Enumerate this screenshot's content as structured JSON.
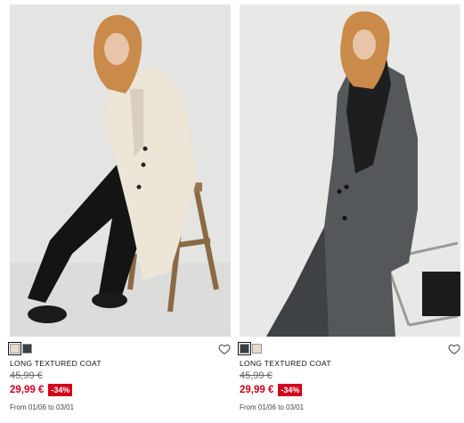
{
  "products": [
    {
      "name": "LONG TEXTURED COAT",
      "old_price": "45,99 €",
      "new_price": "29,99 €",
      "discount": "-34%",
      "availability": "From 01/06 to 03/01",
      "photo": "woman-in-cream-long-coat-on-stool",
      "swatches": [
        {
          "color": "#e7ddcc",
          "selected": true
        },
        {
          "color": "#3b3d40",
          "selected": false
        }
      ],
      "wishlist_icon": "heart-outline-icon"
    },
    {
      "name": "LONG TEXTURED COAT",
      "old_price": "45,99 €",
      "new_price": "29,99 €",
      "discount": "-34%",
      "availability": "From 01/06 to 03/01",
      "photo": "woman-in-grey-long-coat-on-chair",
      "swatches": [
        {
          "color": "#3b3d40",
          "selected": true
        },
        {
          "color": "#e7ddcc",
          "selected": false
        }
      ],
      "wishlist_icon": "heart-outline-icon"
    }
  ],
  "colors": {
    "sale_red": "#d0021b",
    "background": "#ffffff",
    "photo_bg": "#e4e4e2"
  }
}
